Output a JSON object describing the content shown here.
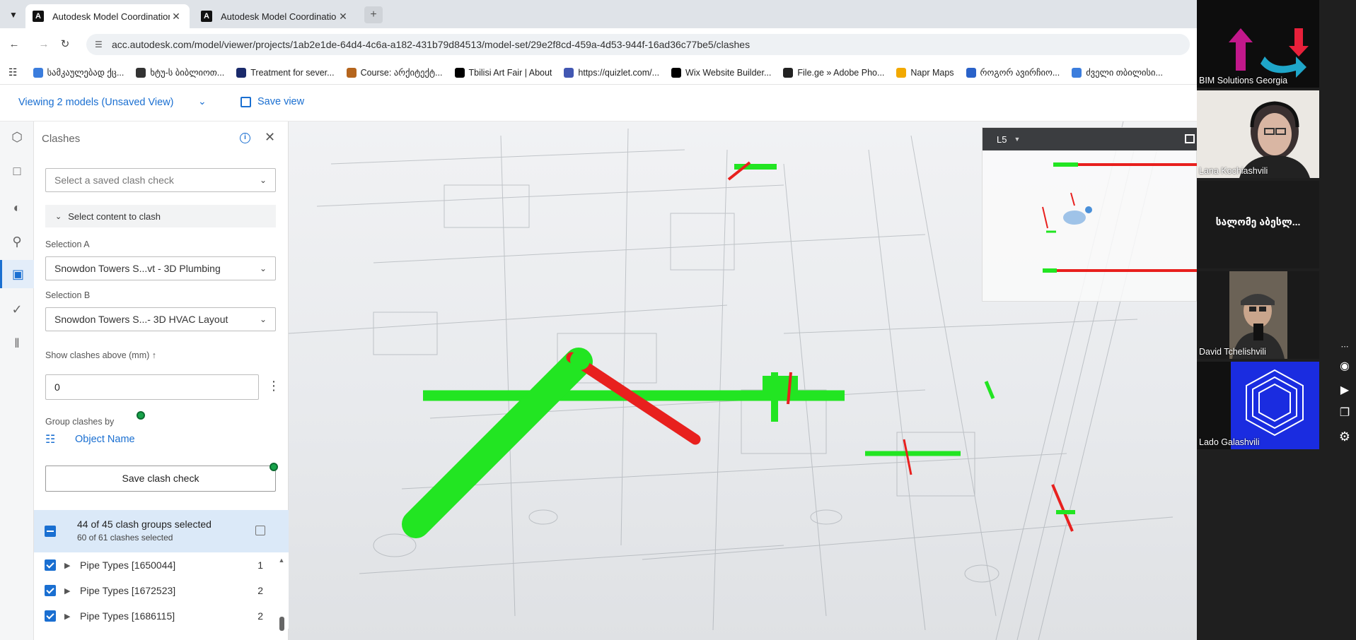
{
  "browser": {
    "tabs": [
      {
        "title": "Autodesk Model Coordination",
        "favicon": "A",
        "active": true
      },
      {
        "title": "Autodesk Model Coordination",
        "favicon": "A",
        "active": false
      }
    ],
    "new_tab": "+",
    "url": "acc.autodesk.com/model/viewer/projects/1ab2e1de-64d4-4c6a-a182-431b79d84513/model-set/29e2f8cd-459a-4d53-944f-16ad36c77be5/clashes",
    "bookmarks": [
      {
        "label": "სამკაულებად ქც...",
        "color": "#3b7ddd"
      },
      {
        "label": "ხტუ-ს ბიბლიოთ...",
        "color": "#333333"
      },
      {
        "label": "Treatment for sever...",
        "color": "#1a2a6b"
      },
      {
        "label": "Course: არქიტექტ...",
        "color": "#b5651d"
      },
      {
        "label": "Tbilisi Art Fair | About",
        "color": "#000000"
      },
      {
        "label": "https://quizlet.com/...",
        "color": "#4257b2"
      },
      {
        "label": "Wix Website Builder...",
        "color": "#000000"
      },
      {
        "label": "File.ge » Adobe Pho...",
        "color": "#222222"
      },
      {
        "label": "Napr Maps",
        "color": "#f2a900"
      },
      {
        "label": "როგორ ავირჩიო...",
        "color": "#2a62c9"
      },
      {
        "label": "ძველი თბილისი...",
        "color": "#3b7ddd"
      }
    ]
  },
  "app": {
    "viewing_label": "Viewing 2 models (Unsaved View)",
    "save_view_label": "Save view"
  },
  "panel": {
    "title": "Clashes",
    "saved_check_placeholder": "Select a saved clash check",
    "select_content_label": "Select content to clash",
    "selection_a_label": "Selection A",
    "selection_a_value": "Snowdon Towers S...vt - 3D Plumbing",
    "selection_b_label": "Selection B",
    "selection_b_value": "Snowdon Towers S...- 3D HVAC Layout",
    "threshold_label": "Show clashes above (mm) ↑",
    "threshold_value": "0",
    "group_by_label": "Group clashes by",
    "group_by_value": "Object Name",
    "save_check_label": "Save clash check",
    "summary_groups": "44 of 45 clash groups selected",
    "summary_clashes": "60 of 61 clashes selected",
    "rows": [
      {
        "name": "Pipe Types [1650044]",
        "count": "1"
      },
      {
        "name": "Pipe Types [1672523]",
        "count": "2"
      },
      {
        "name": "Pipe Types [1686115]",
        "count": "2"
      }
    ]
  },
  "viewer": {
    "level_label": "L5",
    "clash_colors": {
      "clashing": "#e8201e",
      "clashed_against": "#22e522"
    }
  },
  "video_call": {
    "participants": [
      {
        "name": "BIM Solutions Georgia"
      },
      {
        "name": "Lana Kochiashvili"
      },
      {
        "name": "სალომე აბესლ..."
      },
      {
        "name": "David Tchelishvili"
      },
      {
        "name": "Lado Galashvili"
      }
    ]
  }
}
